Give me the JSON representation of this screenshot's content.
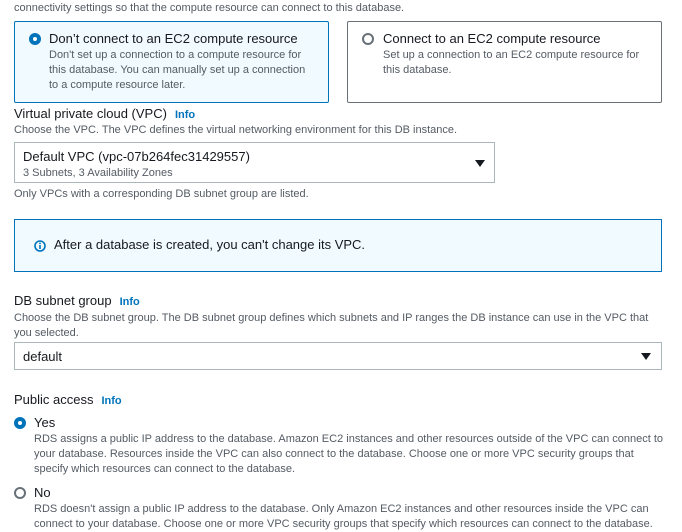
{
  "top_partial_text": "connectivity settings so that the compute resource can connect to this database.",
  "ec2": {
    "options": [
      {
        "title": "Don’t connect to an EC2 compute resource",
        "desc": "Don't set up a connection to a compute resource for this database. You can manually set up a connection to a compute resource later.",
        "selected": true
      },
      {
        "title": "Connect to an EC2 compute resource",
        "desc": "Set up a connection to an EC2 compute resource for this database.",
        "selected": false
      }
    ]
  },
  "vpc": {
    "label": "Virtual private cloud (VPC)",
    "info": "Info",
    "description": "Choose the VPC. The VPC defines the virtual networking environment for this DB instance.",
    "selected_value": "Default VPC (vpc-07b264fec31429557)",
    "selected_sub": "3 Subnets, 3 Availability Zones",
    "hint": "Only VPCs with a corresponding DB subnet group are listed.",
    "alert": "After a database is created, you can't change its VPC."
  },
  "subnet": {
    "label": "DB subnet group",
    "info": "Info",
    "description": "Choose the DB subnet group. The DB subnet group defines which subnets and IP ranges the DB instance can use in the VPC that you selected.",
    "selected_value": "default"
  },
  "public_access": {
    "label": "Public access",
    "info": "Info",
    "options": [
      {
        "title": "Yes",
        "desc": "RDS assigns a public IP address to the database. Amazon EC2 instances and other resources outside of the VPC can connect to your database. Resources inside the VPC can also connect to the database. Choose one or more VPC security groups that specify which resources can connect to the database.",
        "selected": true
      },
      {
        "title": "No",
        "desc": "RDS doesn't assign a public IP address to the database. Only Amazon EC2 instances and other resources inside the VPC can connect to your database. Choose one or more VPC security groups that specify which resources can connect to the database.",
        "selected": false
      }
    ]
  },
  "colors": {
    "accent": "#0073bb",
    "alert_bg": "#f1faff",
    "selected_bg": "#f1faff"
  }
}
